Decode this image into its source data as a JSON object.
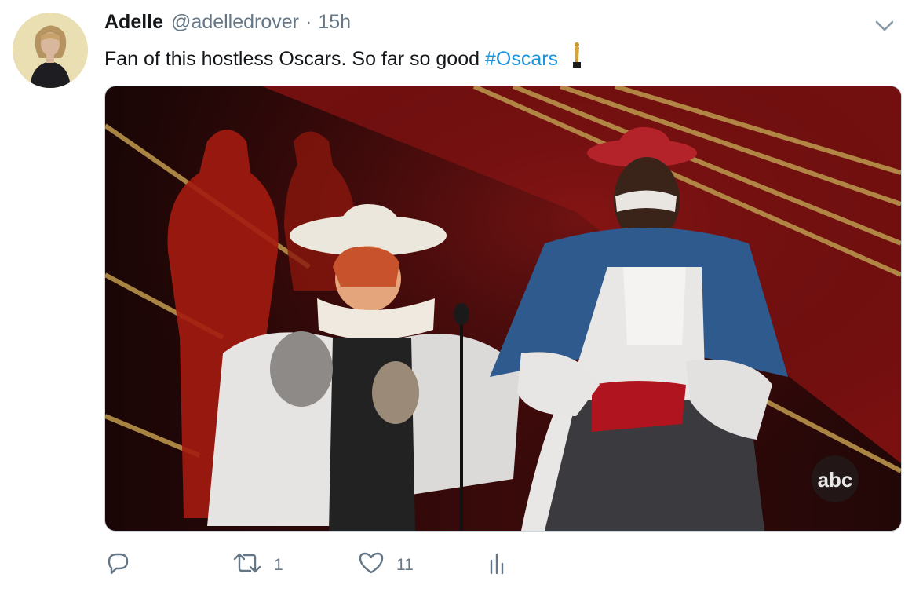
{
  "tweet": {
    "author_name": "Adelle",
    "author_handle": "@adelledrover",
    "separator": "·",
    "time": "15h",
    "text_plain": "Fan of this hostless Oscars. So far so good",
    "hashtag": "#Oscars",
    "emoji": "oscar-trophy-emoji",
    "media": {
      "watermark": "abc"
    },
    "actions": {
      "reply": {
        "icon": "reply-icon",
        "count": ""
      },
      "retweet": {
        "icon": "retweet-icon",
        "count": "1"
      },
      "like": {
        "icon": "heart-icon",
        "count": "11"
      },
      "analytics": {
        "icon": "analytics-icon",
        "count": ""
      }
    }
  },
  "colors": {
    "link": "#1b95e0",
    "muted": "#657786",
    "text": "#14171a"
  }
}
